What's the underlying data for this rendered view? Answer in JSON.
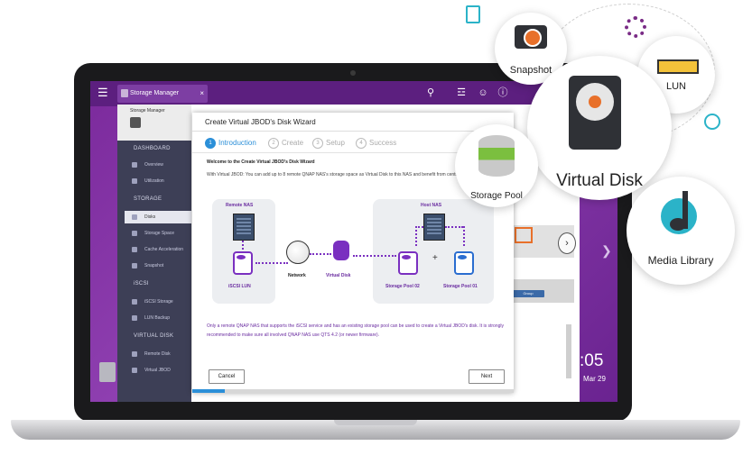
{
  "topbar": {
    "app_tab_label": "Storage Manager",
    "menu_icon": "menu-icon",
    "tab_close": "×"
  },
  "window": {
    "title": "Storage Manager"
  },
  "sidebar": {
    "sections": [
      {
        "header": "DASHBOARD",
        "items": [
          "Overview",
          "Utilization"
        ]
      },
      {
        "header": "STORAGE",
        "items": [
          "Disks",
          "Storage Space",
          "Cache Acceleration",
          "Snapshot"
        ]
      },
      {
        "header": "iSCSI",
        "items": [
          "iSCSI Storage",
          "LUN Backup"
        ]
      },
      {
        "header": "VIRTUAL DISK",
        "items": [
          "Remote Disk",
          "Virtual JBOD"
        ]
      }
    ],
    "selected": "Disks"
  },
  "wizard": {
    "title": "Create Virtual JBOD's Disk Wizard",
    "steps": [
      {
        "num": "1",
        "label": "Introduction",
        "active": true
      },
      {
        "num": "2",
        "label": "Create",
        "active": false
      },
      {
        "num": "3",
        "label": "Setup",
        "active": false
      },
      {
        "num": "4",
        "label": "Success",
        "active": false
      }
    ],
    "heading": "Welcome to the Create Virtual JBOD's Disk Wizard",
    "intro": "With Virtual JBOD: You can add up to 8 remote QNAP NAS's storage space as Virtual Disk to this NAS and benefit from centralized storage space.",
    "diagram": {
      "remote_nas": "Remote NAS",
      "iscsi_lun": "iSCSI LUN",
      "network": "Network",
      "virtual_disk": "Virtual Disk",
      "host_nas": "Host NAS",
      "pool_02": "Storage Pool 02",
      "pool_01": "Storage Pool 01",
      "plus": "+"
    },
    "note": "Only a remote QNAP NAS that supports the iSCSI service and has an existing storage pool can be used to create a Virtual JBOD's disk. It is strongly recommended to make sure all involved QNAP NAS use QTS 4.2 (or newer firmware).",
    "cancel_label": "Cancel",
    "next_label": "Next",
    "progress": 0.1
  },
  "background_panel": {
    "group_button": "Group",
    "clock_time": ":05",
    "clock_date": "Mar 29"
  },
  "bubbles": {
    "snapshot": "Snapshot",
    "lun": "LUN",
    "virtual_disk": "Virtual Disk",
    "storage_pool": "Storage Pool",
    "media_library": "Media Library"
  },
  "colors": {
    "qts_purple": "#7b2a9c",
    "accent_blue": "#2b8fd8",
    "diagram_purple": "#7a30c0",
    "sidebar": "#3d3f56"
  }
}
